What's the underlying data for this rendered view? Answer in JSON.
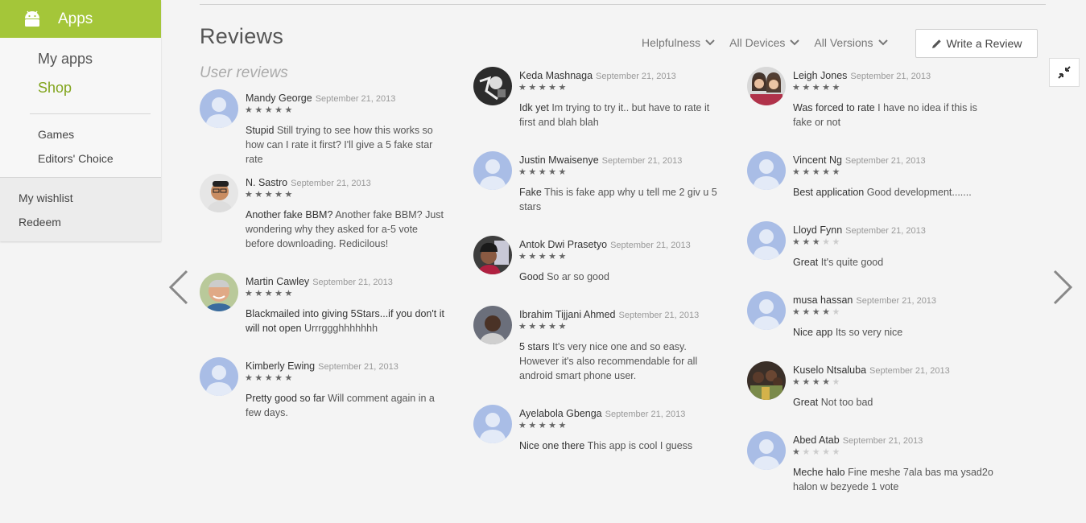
{
  "sidebar": {
    "header_title": "Apps",
    "items_primary": [
      {
        "label": "My apps",
        "active": false
      },
      {
        "label": "Shop",
        "active": true
      }
    ],
    "items_secondary": [
      {
        "label": "Games"
      },
      {
        "label": "Editors' Choice"
      }
    ],
    "items_bottom": [
      {
        "label": "My wishlist"
      },
      {
        "label": "Redeem"
      }
    ]
  },
  "reviews_header": {
    "title": "Reviews",
    "subtitle": "User reviews",
    "filters": [
      {
        "label": "Helpfulness"
      },
      {
        "label": "All Devices"
      },
      {
        "label": "All Versions"
      }
    ],
    "write_review_label": "Write a Review"
  },
  "colors": {
    "brand_green": "#a4c639",
    "active_link": "#82a51e",
    "avatar_default": "#a9bde6"
  },
  "reviews": [
    [
      {
        "name": "Mandy George",
        "date": "September 21, 2013",
        "stars": 5,
        "title": "Stupid",
        "body": "Still trying to see how this works so how can I rate it first? I'll give a 5 fake star rate",
        "avatar": "default"
      },
      {
        "name": "N. Sastro",
        "date": "September 21, 2013",
        "stars": 5,
        "title": "Another fake BBM?",
        "body": "Another fake BBM? Just wondering why they asked for a-5 vote before downloading. Redicilous!",
        "avatar": "photo-man-glasses"
      },
      {
        "name": "Martin Cawley",
        "date": "September 21, 2013",
        "stars": 5,
        "title": "Blackmailed into giving 5Stars...if you don't it will not open",
        "body": "Urrrggghhhhhhh",
        "avatar": "photo-man-smiling"
      },
      {
        "name": "Kimberly Ewing",
        "date": "September 21, 2013",
        "stars": 5,
        "title": "Pretty good so far",
        "body": "Will comment again in a few days.",
        "avatar": "default"
      }
    ],
    [
      {
        "name": "Keda Mashnaga",
        "date": "September 21, 2013",
        "stars": 5,
        "title": "Idk yet",
        "body": "Im trying to try it.. but have to rate it first and blah blah",
        "avatar": "photo-dark"
      },
      {
        "name": "Justin Mwaisenye",
        "date": "September 21, 2013",
        "stars": 5,
        "title": "Fake",
        "body": "This is fake app why u tell me 2 giv u 5 stars",
        "avatar": "default"
      },
      {
        "name": "Antok Dwi Prasetyo",
        "date": "September 21, 2013",
        "stars": 5,
        "title": "Good",
        "body": "So ar so good",
        "avatar": "photo-girl"
      },
      {
        "name": "Ibrahim Tijjani Ahmed",
        "date": "September 21, 2013",
        "stars": 5,
        "title": "5 stars",
        "body": "It's very nice one and so easy. However it's also recommendable for all android smart phone user.",
        "avatar": "photo-man-dark"
      },
      {
        "name": "Ayelabola Gbenga",
        "date": "September 21, 2013",
        "stars": 5,
        "title": "Nice one there",
        "body": "This app is cool I guess",
        "avatar": "default"
      }
    ],
    [
      {
        "name": "Leigh Jones",
        "date": "September 21, 2013",
        "stars": 5,
        "title": "Was forced to rate",
        "body": "I have no idea if this is fake or not",
        "avatar": "photo-two-women"
      },
      {
        "name": "Vincent Ng",
        "date": "September 21, 2013",
        "stars": 5,
        "title": "Best application",
        "body": "Good development.......",
        "avatar": "default"
      },
      {
        "name": "Lloyd Fynn",
        "date": "September 21, 2013",
        "stars": 3,
        "title": "Great",
        "body": "It's quite good",
        "avatar": "default"
      },
      {
        "name": "musa hassan",
        "date": "September 21, 2013",
        "stars": 4,
        "title": "Nice app",
        "body": "Its so very nice",
        "avatar": "default"
      },
      {
        "name": "Kuselo Ntsaluba",
        "date": "September 21, 2013",
        "stars": 4,
        "title": "Great",
        "body": "Not too bad",
        "avatar": "photo-group"
      },
      {
        "name": "Abed Atab",
        "date": "September 21, 2013",
        "stars": 1,
        "title": "Meche halo",
        "body": "Fine meshe 7ala bas ma ysad2o halon w bezyede 1 vote",
        "avatar": "default"
      }
    ]
  ]
}
